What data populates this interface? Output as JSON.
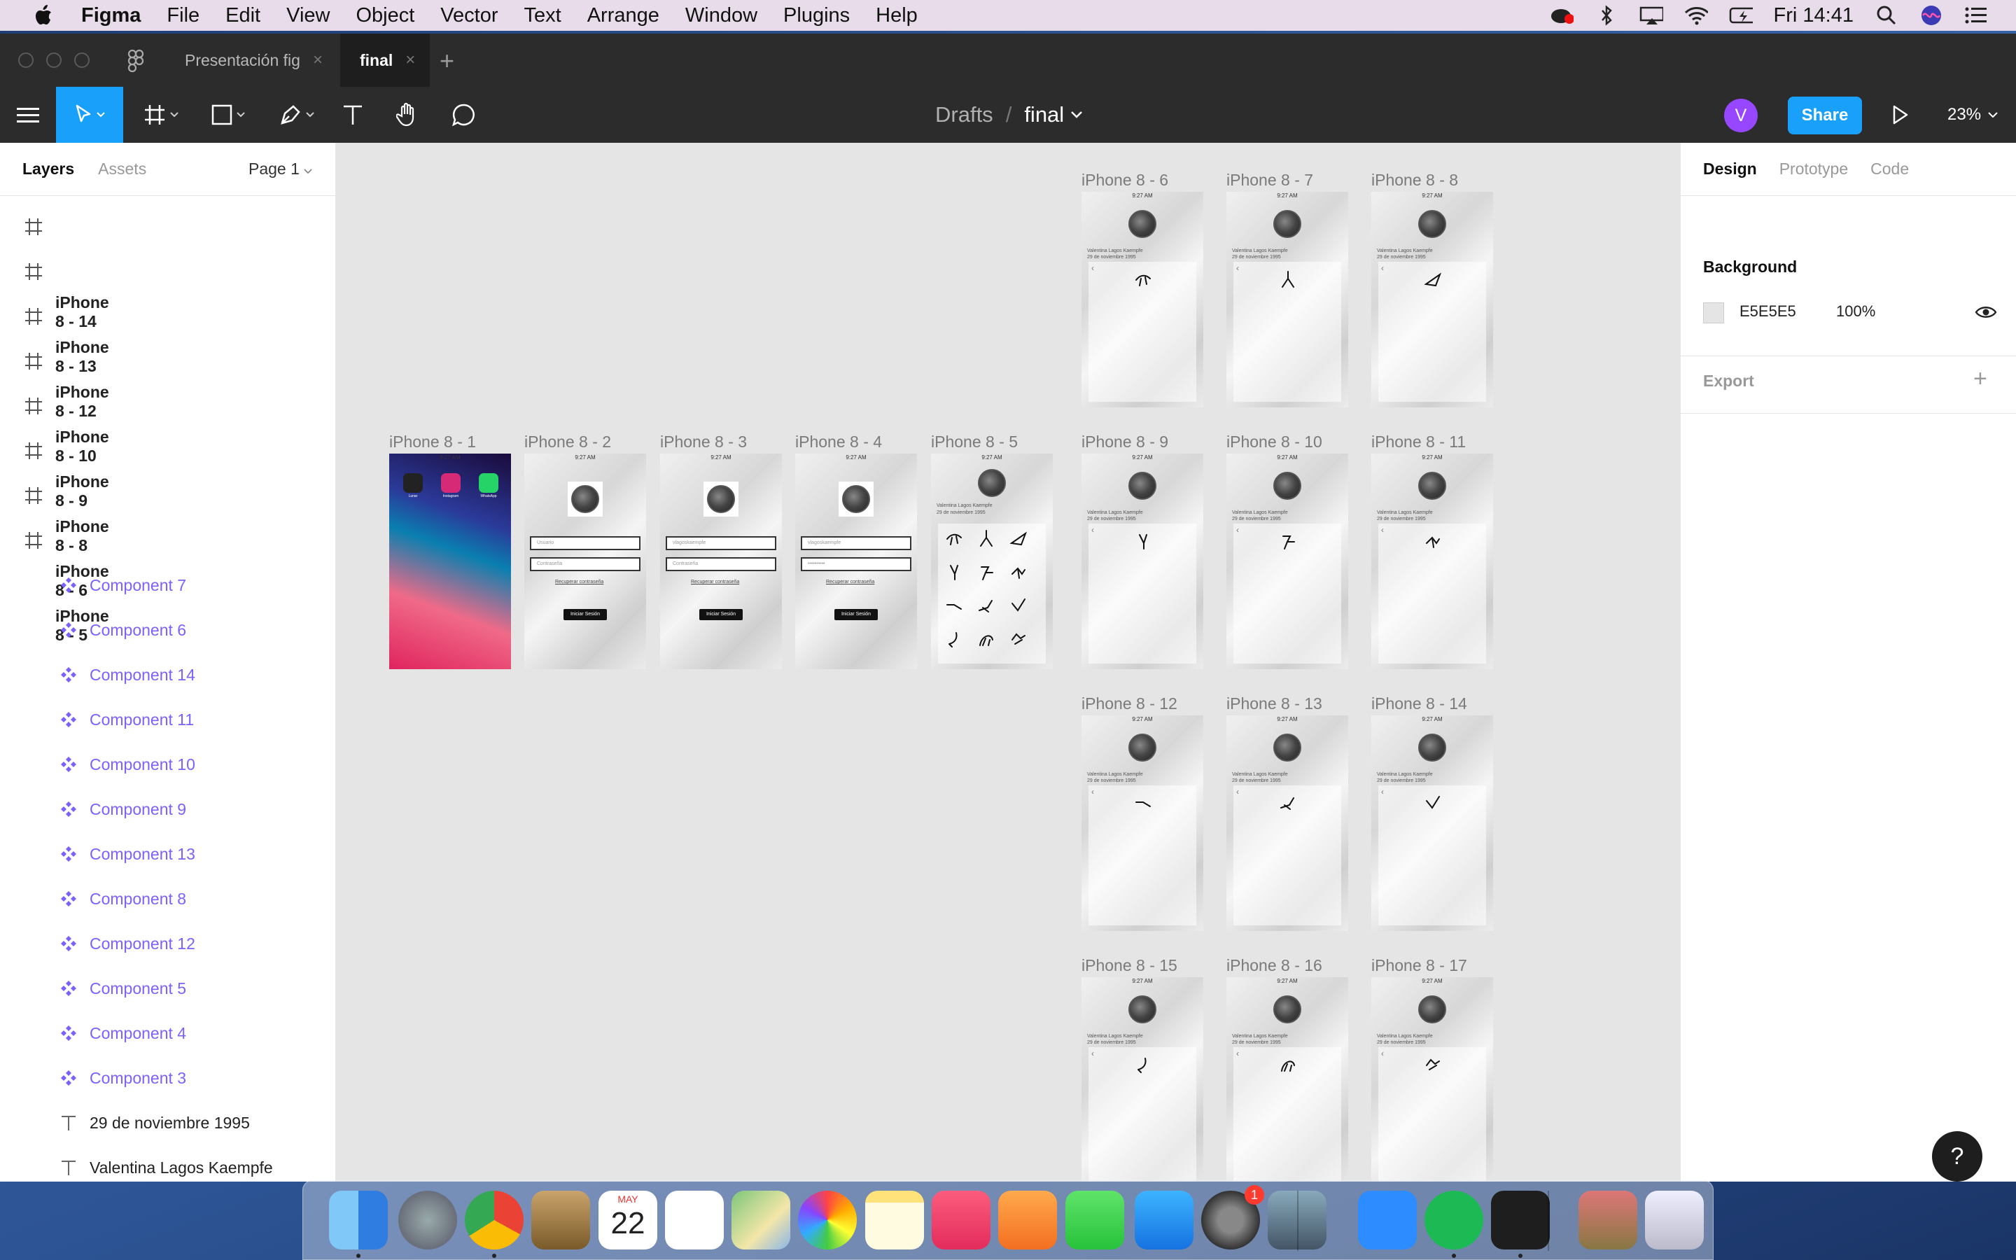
{
  "menubar": {
    "app_name": "Figma",
    "items": [
      "File",
      "Edit",
      "View",
      "Object",
      "Vector",
      "Text",
      "Arrange",
      "Window",
      "Plugins",
      "Help"
    ],
    "clock": "Fri 14:41"
  },
  "tabs": [
    {
      "label": "Presentación fig"
    },
    {
      "label": "final"
    }
  ],
  "tab_close_glyph": "×",
  "tab_add_glyph": "+",
  "toolbar": {
    "breadcrumb_parent": "Drafts",
    "breadcrumb_sep": "/",
    "file_name": "final",
    "avatar_initial": "V",
    "share_label": "Share",
    "zoom": "23%"
  },
  "left_panel": {
    "tab_layers": "Layers",
    "tab_assets": "Assets",
    "page": "Page 1",
    "layers": [
      {
        "name": "iPhone 8 - 14",
        "type": "frame"
      },
      {
        "name": "iPhone 8 - 13",
        "type": "frame"
      },
      {
        "name": "iPhone 8 - 12",
        "type": "frame"
      },
      {
        "name": "iPhone 8 - 10",
        "type": "frame"
      },
      {
        "name": "iPhone 8 - 9",
        "type": "frame"
      },
      {
        "name": "iPhone 8 - 8",
        "type": "frame"
      },
      {
        "name": "iPhone 8 - 6",
        "type": "frame"
      },
      {
        "name": "iPhone 8 - 5",
        "type": "frame"
      },
      {
        "name": "Component 7",
        "type": "component"
      },
      {
        "name": "Component 6",
        "type": "component"
      },
      {
        "name": "Component 14",
        "type": "component"
      },
      {
        "name": "Component 11",
        "type": "component"
      },
      {
        "name": "Component 10",
        "type": "component"
      },
      {
        "name": "Component 9",
        "type": "component"
      },
      {
        "name": "Component 13",
        "type": "component"
      },
      {
        "name": "Component 8",
        "type": "component"
      },
      {
        "name": "Component 12",
        "type": "component"
      },
      {
        "name": "Component 5",
        "type": "component"
      },
      {
        "name": "Component 4",
        "type": "component"
      },
      {
        "name": "Component 3",
        "type": "component"
      },
      {
        "name": "29 de noviembre 1995",
        "type": "text"
      },
      {
        "name": "Valentina Lagos Kaempfe",
        "type": "text"
      }
    ]
  },
  "right_panel": {
    "tab_design": "Design",
    "tab_prototype": "Prototype",
    "tab_code": "Code",
    "background_title": "Background",
    "background_hex": "E5E5E5",
    "background_opacity": "100%",
    "export_title": "Export",
    "export_add": "+"
  },
  "help_label": "?",
  "canvas": {
    "frame_labels": {
      "f1": "iPhone 8 - 1",
      "f2": "iPhone 8 - 2",
      "f3": "iPhone 8 - 3",
      "f4": "iPhone 8 - 4",
      "f5": "iPhone 8 - 5",
      "f6": "iPhone 8 - 6",
      "f7": "iPhone 8 - 7",
      "f8": "iPhone 8 - 8",
      "f9": "iPhone 8 - 9",
      "f10": "iPhone 8 - 10",
      "f11": "iPhone 8 - 11",
      "f12": "iPhone 8 - 12",
      "f13": "iPhone 8 - 13",
      "f14": "iPhone 8 - 14",
      "f15": "iPhone 8 - 15",
      "f16": "iPhone 8 - 16",
      "f17": "iPhone 8 - 17"
    },
    "status_time": "9:27 AM",
    "login_field_user_placeholder": "Usuario",
    "login_field_user_value": "vlagoskaempfe",
    "login_field_password_placeholder": "Contraseña",
    "login_field_password_value": "••••••••••",
    "login_link": "Recuperar contraseña",
    "login_button": "Iniciar Sesión",
    "profile_name": "Valentina Lagos Kaempfe",
    "profile_date": "29 de noviembre 1995",
    "home_apps": [
      "Lunar",
      "Instagram",
      "WhatsApp"
    ]
  },
  "dock": {
    "apps": [
      "Finder",
      "Launchpad",
      "Chrome",
      "Preview",
      "Calendar",
      "Reminders",
      "Maps",
      "Photos",
      "Notes",
      "Music",
      "Books",
      "FaceTime",
      "App Store",
      "System Preferences",
      "Image Capture",
      "Zoom",
      "Spotify",
      "Figma",
      "Photos Library",
      "Trash"
    ],
    "calendar_month": "MAY",
    "calendar_day": "22",
    "system_prefs_badge": "1"
  },
  "colors": {
    "accent": "#18a0fb",
    "component": "#7b61ff",
    "toolbar_bg": "#2c2c2c",
    "canvas_bg": "#e5e5e5"
  }
}
